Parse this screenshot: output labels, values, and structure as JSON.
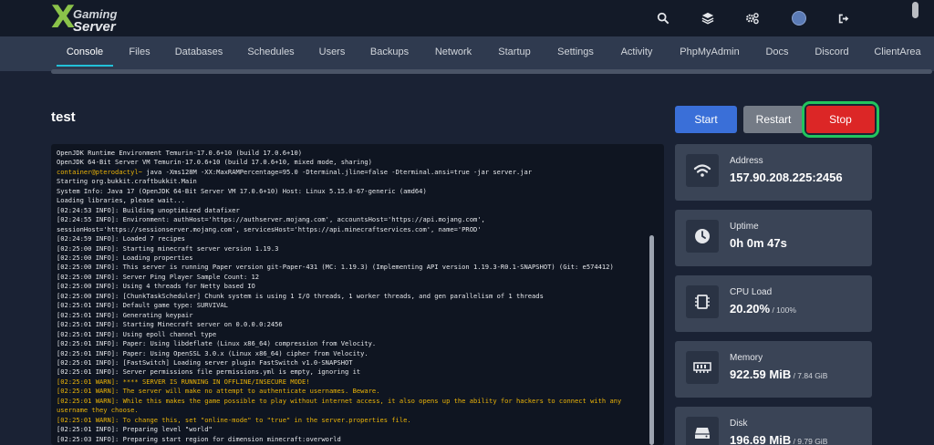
{
  "brand": {
    "x": "X",
    "line1": "Gaming",
    "line2": "Server"
  },
  "topbar_icons": [
    "search-icon",
    "layers-icon",
    "settings-icon",
    "avatar",
    "logout-icon"
  ],
  "nav": {
    "tabs": [
      "Console",
      "Files",
      "Databases",
      "Schedules",
      "Users",
      "Backups",
      "Network",
      "Startup",
      "Settings",
      "Activity",
      "PhpMyAdmin",
      "Docs",
      "Discord",
      "ClientArea"
    ],
    "active": "Console",
    "accent": "#22c1d8"
  },
  "server": {
    "name": "test"
  },
  "power": {
    "start": "Start",
    "restart": "Restart",
    "stop": "Stop"
  },
  "colors": {
    "start": "#3a6fd8",
    "restart": "#747b86",
    "stop": "#dc2626",
    "highlight": "#22c55e",
    "warn": "#eab308"
  },
  "console": {
    "prompt_user": "container@pterodactyl~",
    "lines": [
      {
        "t": "OpenJDK Runtime Environment Temurin-17.0.6+10 (build 17.0.6+10)"
      },
      {
        "t": "OpenJDK 64-Bit Server VM Temurin-17.0.6+10 (build 17.0.6+10, mixed mode, sharing)"
      },
      {
        "t": " java -Xms128M -XX:MaxRAMPercentage=95.0 -Dterminal.jline=false -Dterminal.ansi=true -jar server.jar",
        "prompt": true
      },
      {
        "t": "Starting org.bukkit.craftbukkit.Main"
      },
      {
        "t": "System Info: Java 17 (OpenJDK 64-Bit Server VM 17.0.6+10) Host: Linux 5.15.0-67-generic (amd64)"
      },
      {
        "t": "Loading libraries, please wait..."
      },
      {
        "t": "[02:24:53 INFO]: Building unoptimized datafixer"
      },
      {
        "t": "[02:24:55 INFO]: Environment: authHost='https://authserver.mojang.com', accountsHost='https://api.mojang.com', sessionHost='https://sessionserver.mojang.com', servicesHost='https://api.minecraftservices.com', name='PROD'"
      },
      {
        "t": "[02:24:59 INFO]: Loaded 7 recipes"
      },
      {
        "t": "[02:25:00 INFO]: Starting minecraft server version 1.19.3"
      },
      {
        "t": "[02:25:00 INFO]: Loading properties"
      },
      {
        "t": "[02:25:00 INFO]: This server is running Paper version git-Paper-431 (MC: 1.19.3) (Implementing API version 1.19.3-R0.1-SNAPSHOT) (Git: e574412)"
      },
      {
        "t": "[02:25:00 INFO]: Server Ping Player Sample Count: 12"
      },
      {
        "t": "[02:25:00 INFO]: Using 4 threads for Netty based IO"
      },
      {
        "t": "[02:25:00 INFO]: [ChunkTaskScheduler] Chunk system is using 1 I/O threads, 1 worker threads, and gen parallelism of 1 threads"
      },
      {
        "t": "[02:25:01 INFO]: Default game type: SURVIVAL"
      },
      {
        "t": "[02:25:01 INFO]: Generating keypair"
      },
      {
        "t": "[02:25:01 INFO]: Starting Minecraft server on 0.0.0.0:2456"
      },
      {
        "t": "[02:25:01 INFO]: Using epoll channel type"
      },
      {
        "t": "[02:25:01 INFO]: Paper: Using libdeflate (Linux x86_64) compression from Velocity."
      },
      {
        "t": "[02:25:01 INFO]: Paper: Using OpenSSL 3.0.x (Linux x86_64) cipher from Velocity."
      },
      {
        "t": "[02:25:01 INFO]: [FastSwitch] Loading server plugin FastSwitch v1.0-SNAPSHOT"
      },
      {
        "t": "[02:25:01 INFO]: Server permissions file permissions.yml is empty, ignoring it"
      },
      {
        "t": "[02:25:01 WARN]: **** SERVER IS RUNNING IN OFFLINE/INSECURE MODE!",
        "warn": true
      },
      {
        "t": "[02:25:01 WARN]: The server will make no attempt to authenticate usernames. Beware.",
        "warn": true
      },
      {
        "t": "[02:25:01 WARN]: While this makes the game possible to play without internet access, it also opens up the ability for hackers to connect with any username they choose.",
        "warn": true
      },
      {
        "t": "[02:25:01 WARN]: To change this, set \"online-mode\" to \"true\" in the server.properties file.",
        "warn": true
      },
      {
        "t": "[02:25:01 INFO]: Preparing level \"world\""
      },
      {
        "t": "[02:25:03 INFO]: Preparing start region for dimension minecraft:overworld"
      }
    ]
  },
  "stats": [
    {
      "label": "Address",
      "value": "157.90.208.225:2456",
      "sub": "",
      "icon": "wifi-icon"
    },
    {
      "label": "Uptime",
      "value": "0h 0m 47s",
      "sub": "",
      "icon": "clock-icon"
    },
    {
      "label": "CPU Load",
      "value": "20.20%",
      "sub": " / 100%",
      "icon": "cpu-icon"
    },
    {
      "label": "Memory",
      "value": "922.59 MiB",
      "sub": " / 7.84 GiB",
      "icon": "memory-icon"
    },
    {
      "label": "Disk",
      "value": "196.69 MiB",
      "sub": " / 9.79 GiB",
      "icon": "disk-icon"
    }
  ]
}
